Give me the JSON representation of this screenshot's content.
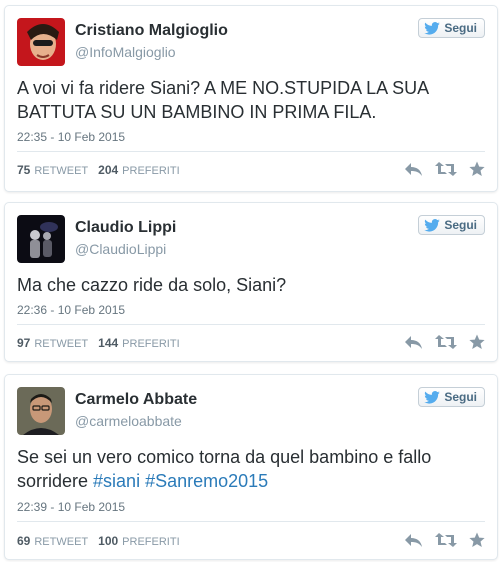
{
  "colors": {
    "hashtag": "#2b7bb9",
    "follow_text": "#4a6b83",
    "bird": "#55acee",
    "meta": "#8899a6"
  },
  "tweets": [
    {
      "name": "Cristiano Malgioglio",
      "handle": "@InfoMalgioglio",
      "follow_label": "Segui",
      "text_parts": [
        {
          "t": "A voi vi fa ridere Siani? A ME NO.STUPIDA LA SUA BATTUTA SU UN BAMBINO  IN PRIMA FILA.",
          "hashtag": false
        }
      ],
      "time": "22:35 - 10 Feb 2015",
      "retweets": "75",
      "retweets_label": "RETWEET",
      "favorites": "204",
      "favorites_label": "PREFERITI",
      "avatar_icon": "avatar-red-portrait",
      "actions": [
        "reply-icon",
        "retweet-icon",
        "favorite-icon"
      ]
    },
    {
      "name": "Claudio Lippi",
      "handle": "@ClaudioLippi",
      "follow_label": "Segui",
      "text_parts": [
        {
          "t": "Ma che cazzo ride da solo, Siani?",
          "hashtag": false
        }
      ],
      "time": "22:36 - 10 Feb 2015",
      "retweets": "97",
      "retweets_label": "RETWEET",
      "favorites": "144",
      "favorites_label": "PREFERITI",
      "avatar_icon": "avatar-dark-stage",
      "actions": [
        "reply-icon",
        "retweet-icon",
        "favorite-icon"
      ]
    },
    {
      "name": "Carmelo Abbate",
      "handle": "@carmeloabbate",
      "follow_label": "Segui",
      "text_parts": [
        {
          "t": "Se sei un vero comico torna da quel bambino e fallo sorridere ",
          "hashtag": false
        },
        {
          "t": "#siani",
          "hashtag": true
        },
        {
          "t": " ",
          "hashtag": false
        },
        {
          "t": "#Sanremo2015",
          "hashtag": true
        }
      ],
      "time": "22:39 - 10 Feb 2015",
      "retweets": "69",
      "retweets_label": "RETWEET",
      "favorites": "100",
      "favorites_label": "PREFERITI",
      "avatar_icon": "avatar-man-portrait",
      "actions": [
        "reply-icon",
        "retweet-icon",
        "favorite-icon"
      ]
    }
  ]
}
